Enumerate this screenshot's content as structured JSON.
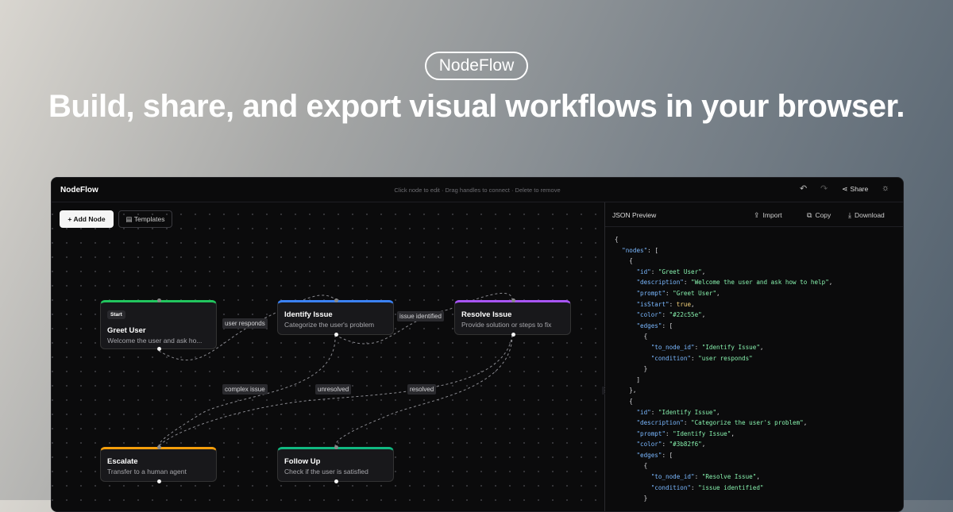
{
  "hero": {
    "brand": "NodeFlow",
    "headline": "Build, share, and export visual workflows in your browser."
  },
  "app": {
    "name": "NodeFlow",
    "hint": "Click node to edit · Drag handles to connect · Delete to remove",
    "toolbar": {
      "undo_icon": "↶",
      "redo_icon": "↷",
      "share_label": "Share",
      "share_icon": "⋖",
      "theme_icon": "☼"
    },
    "canvas": {
      "add_node_label": "Add Node",
      "templates_label": "Templates",
      "nodes": [
        {
          "id": "greet",
          "badge": "Start",
          "title": "Greet User",
          "description": "Welcome the user and ask ho...",
          "color": "#22c55e"
        },
        {
          "id": "identify",
          "title": "Identify Issue",
          "description": "Categorize the user's problem",
          "color": "#3b82f6"
        },
        {
          "id": "resolve",
          "title": "Resolve Issue",
          "description": "Provide solution or steps to fix",
          "color": "#a855f7"
        },
        {
          "id": "escalate",
          "title": "Escalate",
          "description": "Transfer to a human agent",
          "color": "#f59e0b"
        },
        {
          "id": "followup",
          "title": "Follow Up",
          "description": "Check if the user is satisfied",
          "color": "#10b981"
        }
      ],
      "edges": [
        {
          "label": "user responds"
        },
        {
          "label": "issue identified"
        },
        {
          "label": "complex issue"
        },
        {
          "label": "unresolved"
        },
        {
          "label": "resolved"
        }
      ]
    },
    "panel": {
      "title": "JSON Preview",
      "import_label": "Import",
      "copy_label": "Copy",
      "download_label": "Download",
      "json_lines": [
        "{",
        "  \"nodes\": [",
        "    {",
        "      \"id\": \"Greet User\",",
        "      \"description\": \"Welcome the user and ask how to help\",",
        "      \"prompt\": \"Greet User\",",
        "      \"isStart\": true,",
        "      \"color\": \"#22c55e\",",
        "      \"edges\": [",
        "        {",
        "          \"to_node_id\": \"Identify Issue\",",
        "          \"condition\": \"user responds\"",
        "        }",
        "      ]",
        "    },",
        "    {",
        "      \"id\": \"Identify Issue\",",
        "      \"description\": \"Categorize the user's problem\",",
        "      \"prompt\": \"Identify Issue\",",
        "      \"color\": \"#3b82f6\",",
        "      \"edges\": [",
        "        {",
        "          \"to_node_id\": \"Resolve Issue\",",
        "          \"condition\": \"issue identified\"",
        "        }"
      ]
    }
  }
}
